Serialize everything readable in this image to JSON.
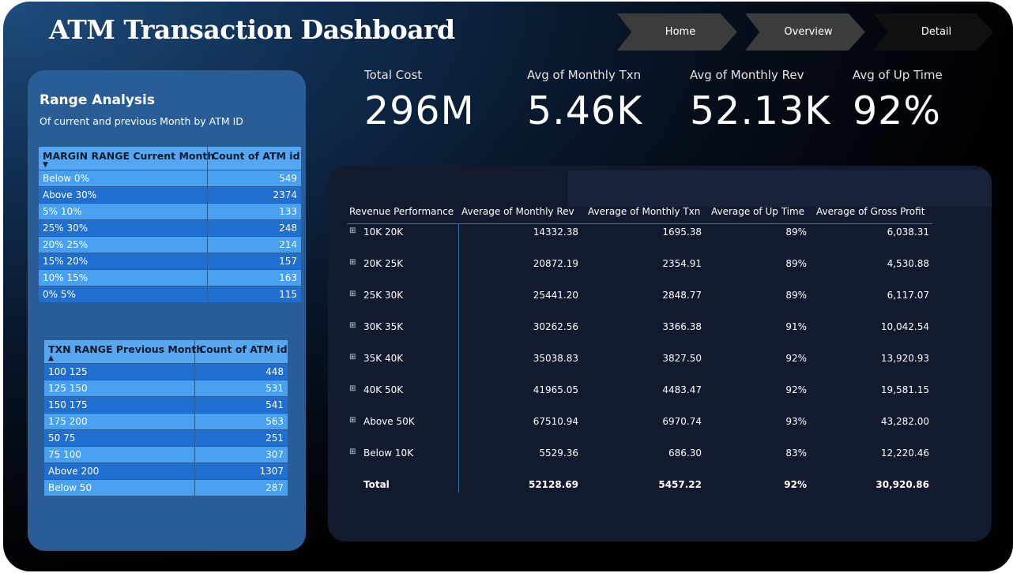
{
  "title": "ATM Transaction Dashboard",
  "nav": {
    "home": "Home",
    "overview": "Overview",
    "detail": "Detail"
  },
  "kpis": [
    {
      "label": "Total Cost",
      "value": "296M"
    },
    {
      "label": "Avg of Monthly Txn",
      "value": "5.46K"
    },
    {
      "label": "Avg of Monthly Rev",
      "value": "52.13K"
    },
    {
      "label": "Avg of Up Time",
      "value": "92%"
    }
  ],
  "range_analysis": {
    "title": "Range Analysis",
    "subtitle": "Of current and  previous Month by ATM ID",
    "margin_table": {
      "headers": [
        "MARGIN RANGE Current Month",
        "Count of ATM id"
      ],
      "sort": "desc",
      "rows": [
        {
          "range": "Below 0%",
          "count": "549"
        },
        {
          "range": "Above 30%",
          "count": "2374"
        },
        {
          "range": "5%  10%",
          "count": "133"
        },
        {
          "range": "25%  30%",
          "count": "248"
        },
        {
          "range": "20%  25%",
          "count": "214"
        },
        {
          "range": "15%  20%",
          "count": "157"
        },
        {
          "range": "10%  15%",
          "count": "163"
        },
        {
          "range": "0%  5%",
          "count": "115"
        }
      ]
    },
    "txn_table": {
      "headers": [
        "TXN RANGE Previous Month",
        "Count of ATM id"
      ],
      "sort": "asc",
      "rows": [
        {
          "range": "100  125",
          "count": "448"
        },
        {
          "range": "125  150",
          "count": "531"
        },
        {
          "range": "150  175",
          "count": "541"
        },
        {
          "range": "175  200",
          "count": "563"
        },
        {
          "range": "50  75",
          "count": "251"
        },
        {
          "range": "75  100",
          "count": "307"
        },
        {
          "range": "Above 200",
          "count": "1307"
        },
        {
          "range": "Below 50",
          "count": "287"
        }
      ]
    }
  },
  "revenue_table": {
    "headers": [
      "Revenue Performance",
      "Average of Monthly Rev",
      "Average of Monthly Txn",
      "Average of Up Time",
      "Average of Gross Profit"
    ],
    "rows": [
      {
        "label": "10K 20K",
        "rev": "14332.38",
        "txn": "1695.38",
        "uptime": "89%",
        "profit": "6,038.31"
      },
      {
        "label": "20K 25K",
        "rev": "20872.19",
        "txn": "2354.91",
        "uptime": "89%",
        "profit": "4,530.88"
      },
      {
        "label": "25K 30K",
        "rev": "25441.20",
        "txn": "2848.77",
        "uptime": "89%",
        "profit": "6,117.07"
      },
      {
        "label": "30K 35K",
        "rev": "30262.56",
        "txn": "3366.38",
        "uptime": "91%",
        "profit": "10,042.54"
      },
      {
        "label": "35K 40K",
        "rev": "35038.83",
        "txn": "3827.50",
        "uptime": "92%",
        "profit": "13,920.93"
      },
      {
        "label": "40K 50K",
        "rev": "41965.05",
        "txn": "4483.47",
        "uptime": "92%",
        "profit": "19,581.15"
      },
      {
        "label": "Above 50K",
        "rev": "67510.94",
        "txn": "6970.74",
        "uptime": "93%",
        "profit": "43,282.00"
      },
      {
        "label": "Below 10K",
        "rev": "5529.36",
        "txn": "686.30",
        "uptime": "83%",
        "profit": "12,220.46"
      }
    ],
    "total": {
      "label": "Total",
      "rev": "52128.69",
      "txn": "5457.22",
      "uptime": "92%",
      "profit": "30,920.86"
    },
    "expand_glyph": "⊞"
  }
}
